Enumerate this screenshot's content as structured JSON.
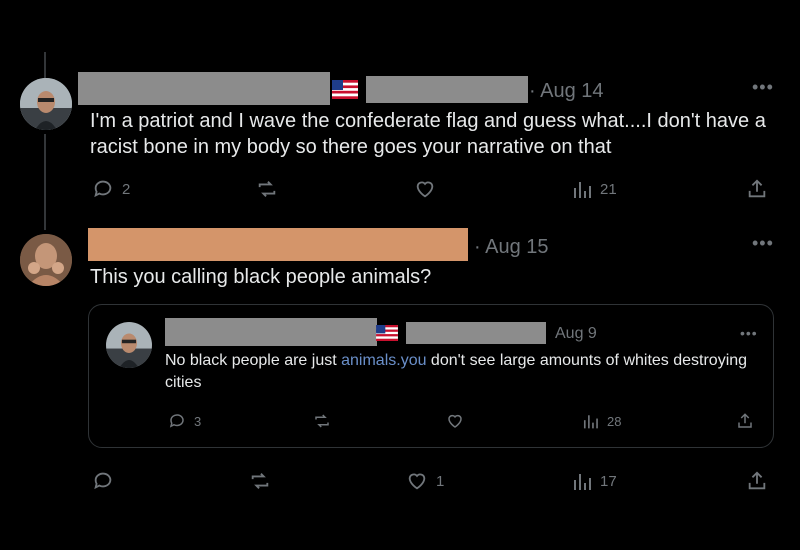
{
  "post1": {
    "date": "· Aug 14",
    "text": "I'm a patriot and I wave the confederate flag and guess what....I don't have a racist bone in my body so there goes your narrative on that",
    "replies": "2",
    "views": "21",
    "more_icon": "more-horizontal-icon"
  },
  "post2": {
    "date": "· Aug 15",
    "text": "This you calling black people animals?",
    "views": "17",
    "likes": "1",
    "more_icon": "more-horizontal-icon",
    "redaction_color": "#d4956a"
  },
  "quote": {
    "date": "Aug 9",
    "text_before_link": "No black people are just ",
    "link_text": "animals.you",
    "text_after_link": " don't see large amounts of whites destroying cities",
    "replies": "3",
    "views": "28"
  },
  "colors": {
    "background": "#000000",
    "text": "#e7e9ea",
    "muted": "#71767b",
    "border": "#2f3336",
    "link": "#6a8fc9",
    "redaction_gray": "#8a8a8a"
  },
  "icons": [
    "reply-icon",
    "repost-icon",
    "like-icon",
    "views-icon",
    "share-icon",
    "us-flag-icon"
  ]
}
